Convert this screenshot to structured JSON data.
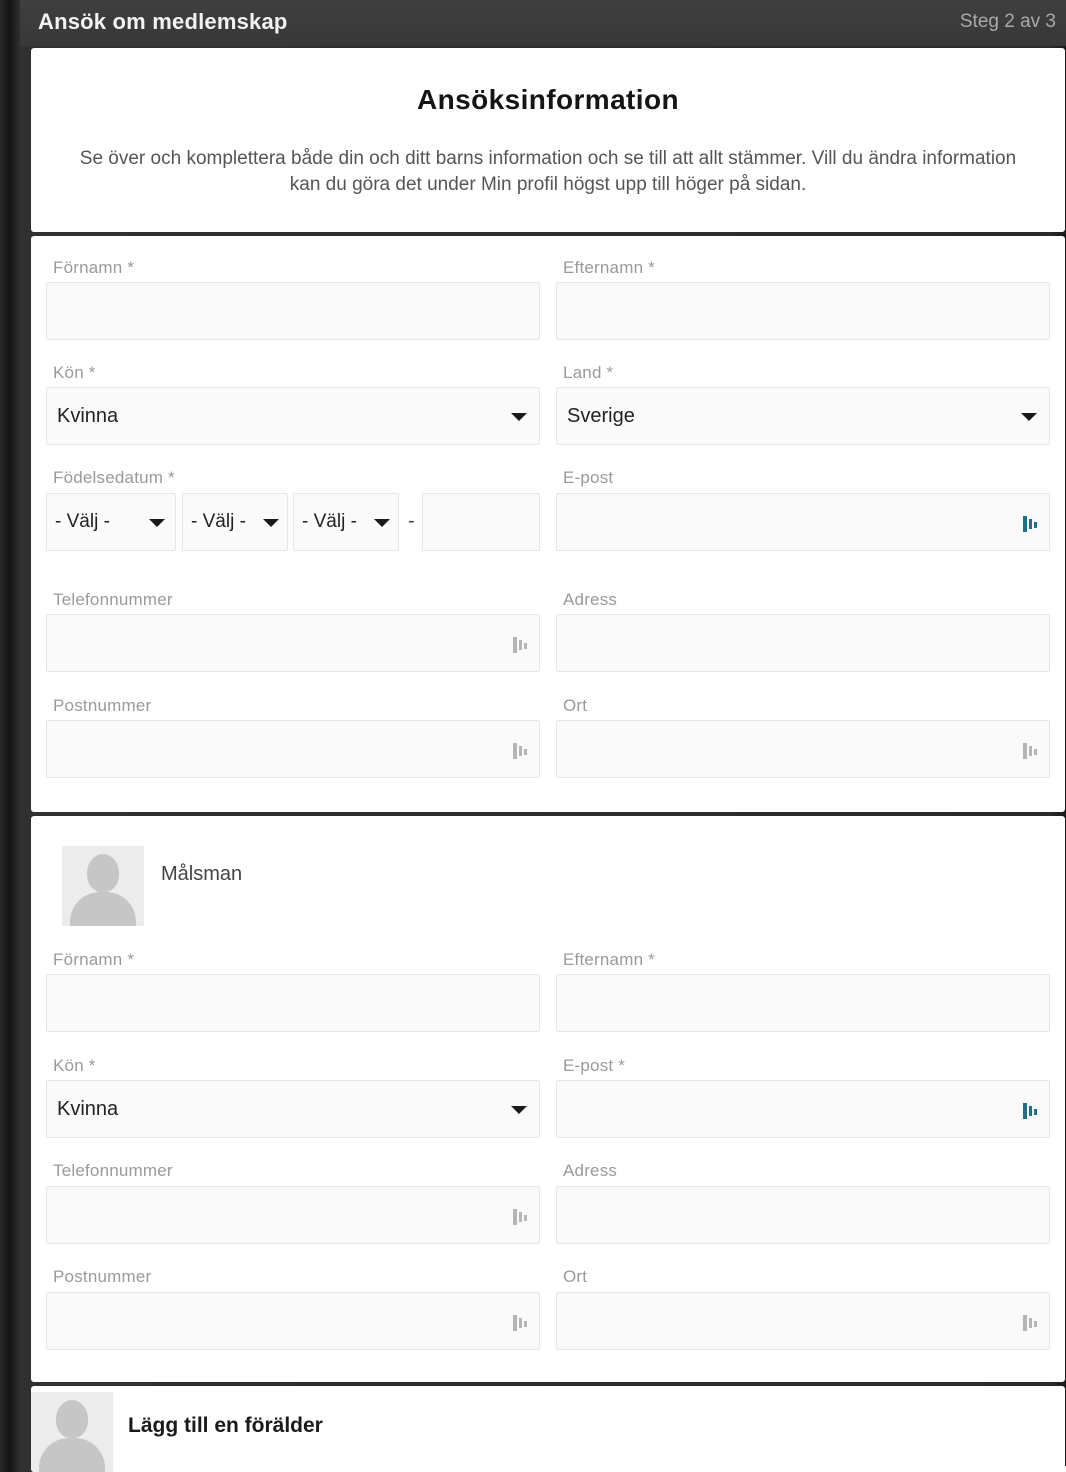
{
  "topbar": {
    "title": "Ansök om medlemskap",
    "step": "Steg 2 av 3"
  },
  "header": {
    "title": "Ansöksinformation",
    "description": "Se över och komplettera både din och ditt barns information och se till att allt stämmer. Vill du ändra information kan du göra det under Min profil högst upp till höger på sidan."
  },
  "child": {
    "first_name_label": "Förnamn *",
    "last_name_label": "Efternamn *",
    "gender_label": "Kön *",
    "gender_value": "Kvinna",
    "country_label": "Land *",
    "country_value": "Sverige",
    "birthdate_label": "Födelsedatum *",
    "birth_year_value": "- Välj -",
    "birth_month_value": "- Välj -",
    "birth_day_value": "- Välj -",
    "birth_separator": "-",
    "email_label": "E-post",
    "phone_label": "Telefonnummer",
    "address_label": "Adress",
    "postcode_label": "Postnummer",
    "city_label": "Ort"
  },
  "guardian": {
    "section_title": "Målsman",
    "first_name_label": "Förnamn *",
    "last_name_label": "Efternamn *",
    "gender_label": "Kön *",
    "gender_value": "Kvinna",
    "email_label": "E-post *",
    "phone_label": "Telefonnummer",
    "address_label": "Adress",
    "postcode_label": "Postnummer",
    "city_label": "Ort"
  },
  "add_parent": {
    "label": "Lägg till en förälder"
  },
  "icons": {
    "password_manager_active": "#1f6f86",
    "password_manager_inactive": "#b5b5b5"
  }
}
